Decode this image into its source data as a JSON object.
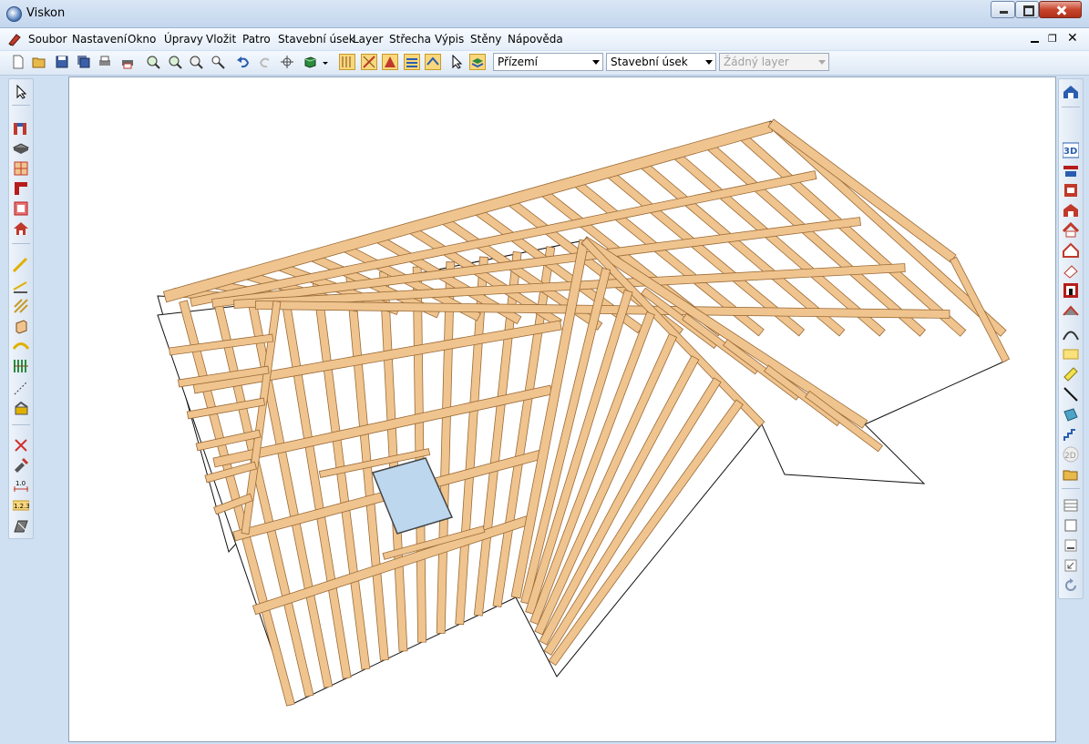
{
  "window": {
    "title": "Viskon"
  },
  "menu": {
    "items": [
      "Soubor",
      "Nastavení",
      "Okno",
      "Úpravy",
      "Vložit",
      "Patro",
      "Stavební úsek",
      "Layer",
      "Střecha",
      "Výpis",
      "Stěny",
      "Nápověda"
    ]
  },
  "toolbar": {
    "floor_select": "Přízemí",
    "section_select": "Stavební úsek",
    "layer_select": "Žádný layer"
  },
  "right_toolbar": {
    "btn_3d": "3D",
    "btn_2d": "2D"
  },
  "left_toolbar": {
    "dim_label_1": "1.0",
    "dim_label_2": "1.2.3"
  },
  "colors": {
    "timber": "#f0c48e",
    "timber_edge": "#9a6a36",
    "window_glass": "#bcd7ee",
    "accent_highlight": "#f9d77c"
  }
}
